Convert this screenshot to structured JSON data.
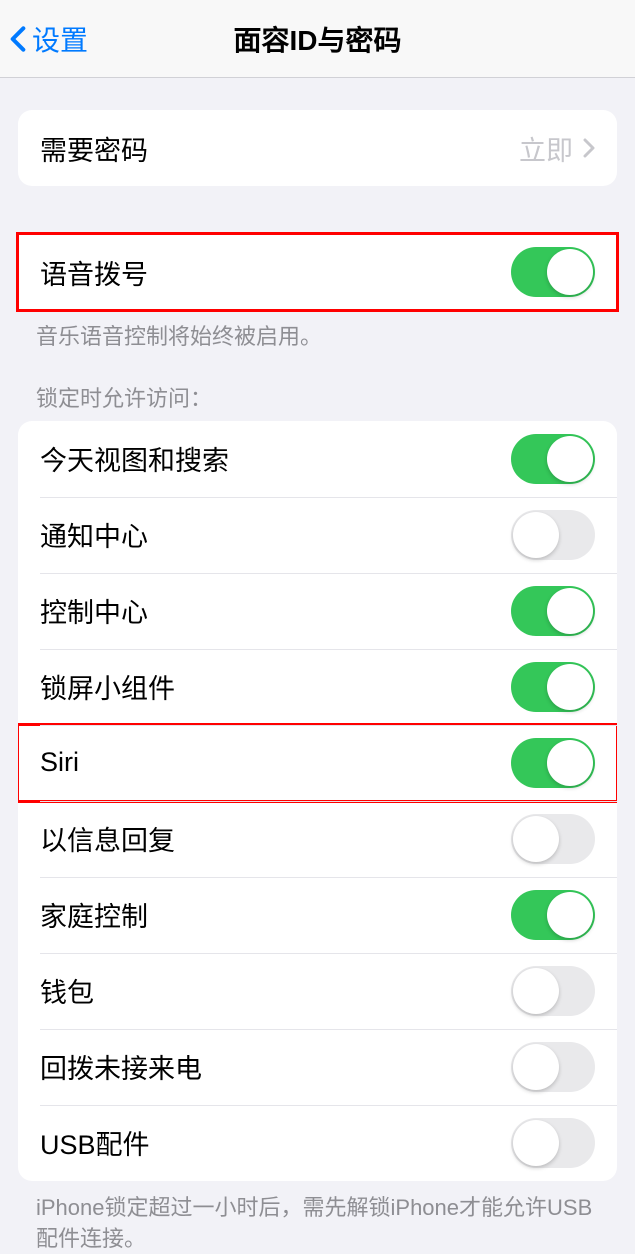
{
  "header": {
    "back_label": "设置",
    "title": "面容ID与密码"
  },
  "require_passcode": {
    "label": "需要密码",
    "value": "立即"
  },
  "voice_dial": {
    "label": "语音拨号",
    "enabled": true,
    "footer": "音乐语音控制将始终被启用。"
  },
  "lock_screen_access": {
    "header": "锁定时允许访问：",
    "items": [
      {
        "label": "今天视图和搜索",
        "enabled": true,
        "highlight": false
      },
      {
        "label": "通知中心",
        "enabled": false,
        "highlight": false
      },
      {
        "label": "控制中心",
        "enabled": true,
        "highlight": false
      },
      {
        "label": "锁屏小组件",
        "enabled": true,
        "highlight": false
      },
      {
        "label": "Siri",
        "enabled": true,
        "highlight": true
      },
      {
        "label": "以信息回复",
        "enabled": false,
        "highlight": false
      },
      {
        "label": "家庭控制",
        "enabled": true,
        "highlight": false
      },
      {
        "label": "钱包",
        "enabled": false,
        "highlight": false
      },
      {
        "label": "回拨未接来电",
        "enabled": false,
        "highlight": false
      },
      {
        "label": "USB配件",
        "enabled": false,
        "highlight": false
      }
    ],
    "footer": "iPhone锁定超过一小时后，需先解锁iPhone才能允许USB配件连接。"
  }
}
